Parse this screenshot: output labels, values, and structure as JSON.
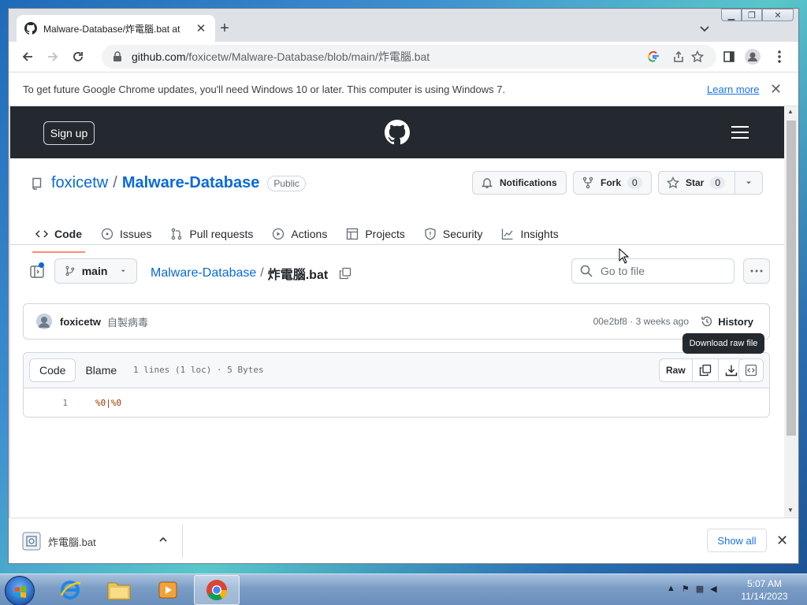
{
  "browser": {
    "tab_title": "Malware-Database/炸電腦.bat at",
    "url_host": "github.com",
    "url_path": "/foxicetw/Malware-Database/blob/main/炸電腦.bat",
    "infobar_text": "To get future Google Chrome updates, you'll need Windows 10 or later. This computer is using Windows 7.",
    "infobar_link": "Learn more"
  },
  "github": {
    "signup_label": "Sign up",
    "owner": "foxicetw",
    "repo": "Malware-Database",
    "visibility": "Public",
    "notifications_label": "Notifications",
    "fork_label": "Fork",
    "fork_count": "0",
    "star_label": "Star",
    "star_count": "0",
    "nav": [
      "Code",
      "Issues",
      "Pull requests",
      "Actions",
      "Projects",
      "Security",
      "Insights"
    ],
    "branch": "main",
    "breadcrumb_repo": "Malware-Database",
    "breadcrumb_file": "炸電腦.bat",
    "search_placeholder": "Go to file",
    "commit_author": "foxicetw",
    "commit_message": "自製病毒",
    "commit_meta": "00e2bf8 · 3 weeks ago",
    "history_label": "History",
    "tooltip": "Download raw file",
    "code_tab": "Code",
    "blame_tab": "Blame",
    "file_info": "1 lines (1 loc) · 5 Bytes",
    "raw_label": "Raw",
    "line_number": "1",
    "line_code": "%0|%0"
  },
  "download": {
    "filename": "炸電腦.bat",
    "show_all": "Show all"
  },
  "taskbar": {
    "time": "5:07 AM",
    "date": "11/14/2023"
  },
  "colors": {
    "header_bg": "#24292f",
    "link": "#0969da",
    "nav_underline": "#fd8c73"
  }
}
